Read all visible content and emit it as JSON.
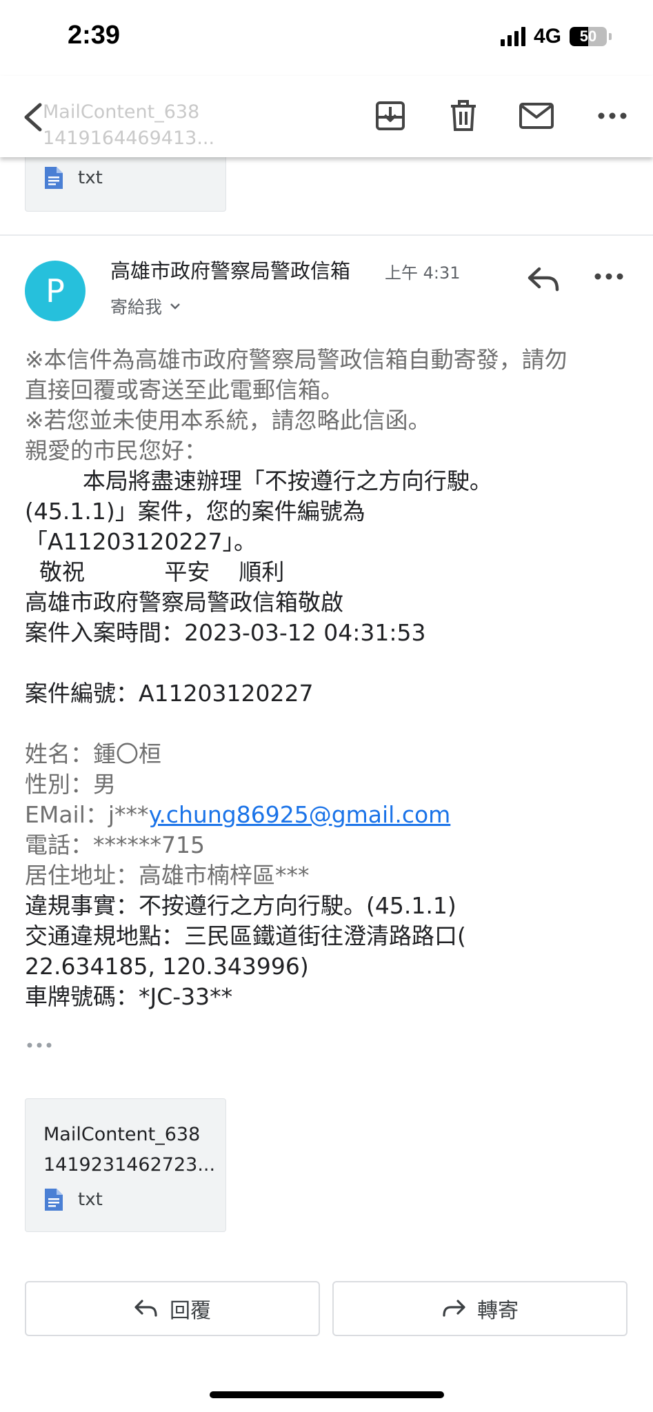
{
  "status_bar": {
    "time": "2:39",
    "network": "4G",
    "battery_level": "50",
    "battery_percent": 50,
    "signal_bars": 4
  },
  "toolbar": {
    "ghost_line1": "MailContent_638",
    "ghost_line2": "1419164469413..."
  },
  "prev_attachment": {
    "ext": "txt"
  },
  "message": {
    "avatar_letter": "P",
    "avatar_color": "#26c0dc",
    "sender": "高雄市政府警察局警政信箱",
    "time": "上午 4:31",
    "to": "寄給我",
    "body": {
      "l1": "※本信件為高雄市政府警察局警政信箱自動寄發，請勿",
      "l2": "直接回覆或寄送至此電郵信箱。",
      "l3": "※若您並未使用本系統，請忽略此信函。",
      "l4": "親愛的市民您好：",
      "l5": "        本局將盡速辦理「不按遵行之方向行駛。",
      "l6": "(45.1.1)」案件，您的案件編號為",
      "l7": "「A11203120227」。",
      "l8": "  敬祝           平安    順利",
      "l9": "高雄市政府警察局警政信箱敬啟",
      "l10": "案件入案時間：2023-03-12 04:31:53",
      "l11": "案件編號：A11203120227",
      "l12": "姓名：鍾〇桓",
      "l13": "性別：男",
      "l14a": "EMail：j***",
      "l14b": "y.chung86925@gmail.com",
      "l15": "電話：******715",
      "l16": "居住地址：高雄市楠梓區***",
      "l17": "違規事實：不按遵行之方向行駛。(45.1.1)",
      "l18": "交通違規地點：三民區鐵道街往澄清路路口(",
      "l19": "22.634185, 120.343996)",
      "l20": "車牌號碼：*JC-33**"
    }
  },
  "attachment": {
    "name_line1": "MailContent_638",
    "name_line2": "1419231462723...",
    "ext": "txt"
  },
  "actions": {
    "reply": "回覆",
    "forward": "轉寄"
  },
  "colors": {
    "link": "#1a73e8",
    "file_icon": "#4a7fd4"
  }
}
